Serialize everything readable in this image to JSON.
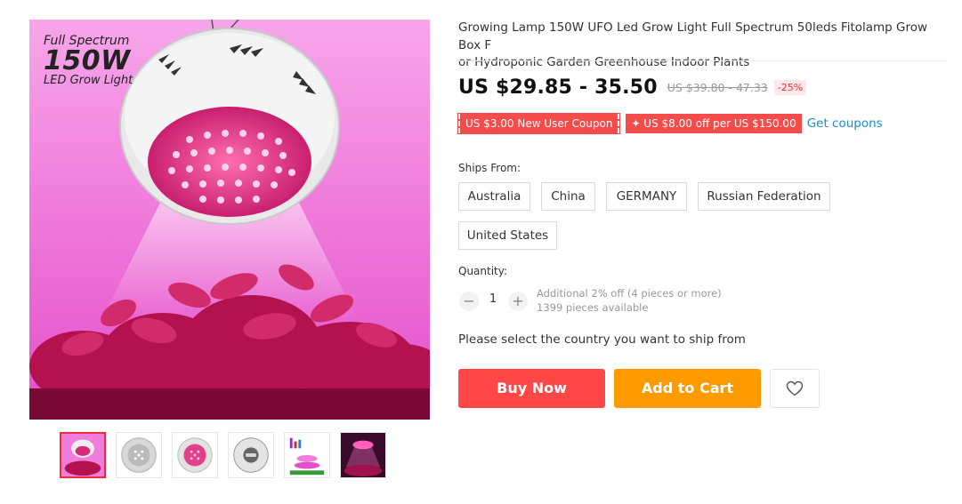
{
  "product": {
    "title": "Growing Lamp 150W UFO Led Grow Light Full Spectrum 50leds Fitolamp Grow Box For Hydroponic Garden Greenhouse Indoor Plants",
    "title_line1": "Growing Lamp 150W UFO Led Grow Light Full Spectrum 50leds Fitolamp Grow Box F",
    "title_line2": "or Hydroponic Garden Greenhouse Indoor Plants"
  },
  "main_image": {
    "label_line1": "Full Spectrum",
    "label_line2": "150W",
    "label_line3": "LED Grow Light",
    "icon": "product-photo"
  },
  "thumbnails": [
    {
      "icon": "lamp-pink-thumb",
      "active": true
    },
    {
      "icon": "lamp-leds-thumb",
      "active": false
    },
    {
      "icon": "lamp-front-thumb",
      "active": false
    },
    {
      "icon": "lamp-back-thumb",
      "active": false
    },
    {
      "icon": "spectrum-chart-thumb",
      "active": false
    },
    {
      "icon": "lamp-dark-thumb",
      "active": false
    }
  ],
  "price": {
    "current": "US $29.85 - 35.50",
    "original": "US $39.80 - 47.33",
    "discount": "-25%"
  },
  "coupons": {
    "new_user": "US $3.00 New User Coupon",
    "store": "✦ US $8.00 off per US $150.00",
    "link": "Get coupons"
  },
  "shipping": {
    "label": "Ships From:",
    "options": [
      "Australia",
      "China",
      "GERMANY",
      "Russian Federation",
      "United States"
    ]
  },
  "quantity": {
    "label": "Quantity:",
    "minus": "−",
    "value": "1",
    "plus": "+",
    "note_discount": "Additional 2% off (4 pieces or more)",
    "note_available": "1399 pieces available"
  },
  "ship_message": "Please select the country you want to ship from",
  "actions": {
    "buy_now": "Buy Now",
    "add_to_cart": "Add to Cart",
    "wishlist_icon": "heart-icon"
  },
  "colors": {
    "buy_now": "#ff4747",
    "add_to_cart": "#ff9a00",
    "coupon": "#f44b4b",
    "link": "#1a8dc8",
    "discount": "#e62e3a"
  }
}
